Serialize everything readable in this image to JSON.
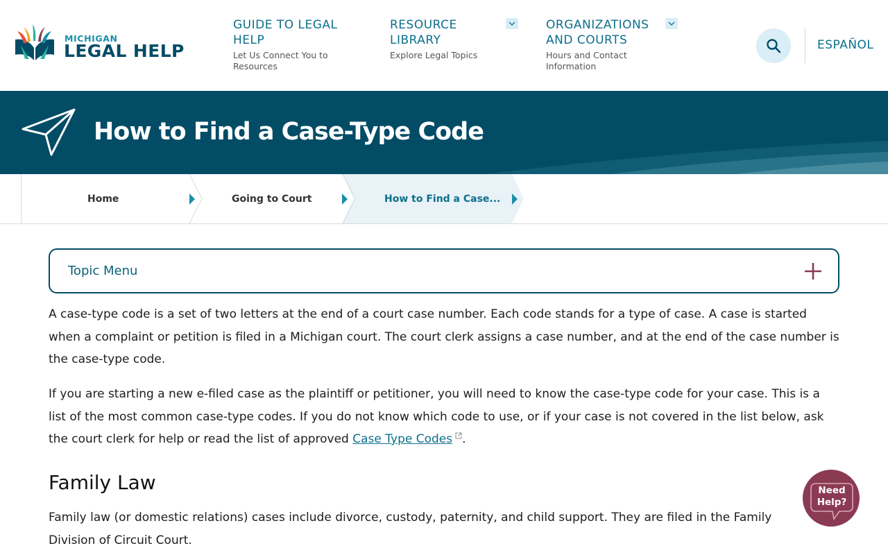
{
  "header": {
    "logo": {
      "small": "MICHIGAN",
      "big": "LEGAL HELP"
    },
    "nav": [
      {
        "title": "GUIDE TO LEGAL HELP",
        "title_line1": "GUIDE TO LEGAL",
        "title_line2": "HELP",
        "sub_line1": "Let Us Connect You to",
        "sub_line2": "Resources"
      },
      {
        "title": "RESOURCE LIBRARY",
        "title_line1": "RESOURCE",
        "title_line2": "LIBRARY",
        "sub_line1": "Explore Legal Topics",
        "sub_line2": ""
      },
      {
        "title": "ORGANIZATIONS AND COURTS",
        "title_line1": "ORGANIZATIONS",
        "title_line2": "AND COURTS",
        "sub_line1": "Hours and Contact",
        "sub_line2": "Information"
      }
    ],
    "language_link": "ESPAÑOL"
  },
  "banner": {
    "title": "How to Find a Case-Type Code"
  },
  "breadcrumb": [
    {
      "label": "Home"
    },
    {
      "label": "Going to Court"
    },
    {
      "label": "How to Find a Case..."
    }
  ],
  "topic_menu": {
    "label": "Topic Menu"
  },
  "content": {
    "intro": "A case-type code is a set of two letters at the end of a court case number. Each code stands for a type of case. A case is started when a complaint or petition is filed in a Michigan court. The court clerk assigns a case number, and at the end of the case number is the case-type code.",
    "para2_before": "If you are starting a new e-filed case as the plaintiff or petitioner, you will need to know the case-type code for your case. This is a list of the most common case-type codes. If you do not know which code to use, or if your case is not covered in the list below, ask the court clerk for help or read the list of approved ",
    "para2_link": "Case Type Codes",
    "para2_after": ".",
    "section_heading": "Family Law",
    "section_text": "Family law (or domestic relations) cases include divorce, custody, paternity, and child support. They are filed in the Family Division of Circuit Court."
  },
  "need_help": {
    "line1": "Need",
    "line2": "Help?"
  },
  "colors": {
    "brand_dark": "#034c66",
    "brand_teal": "#0d6f8c",
    "accent_maroon": "#8b3a54",
    "light_blue": "#d9eef6"
  }
}
